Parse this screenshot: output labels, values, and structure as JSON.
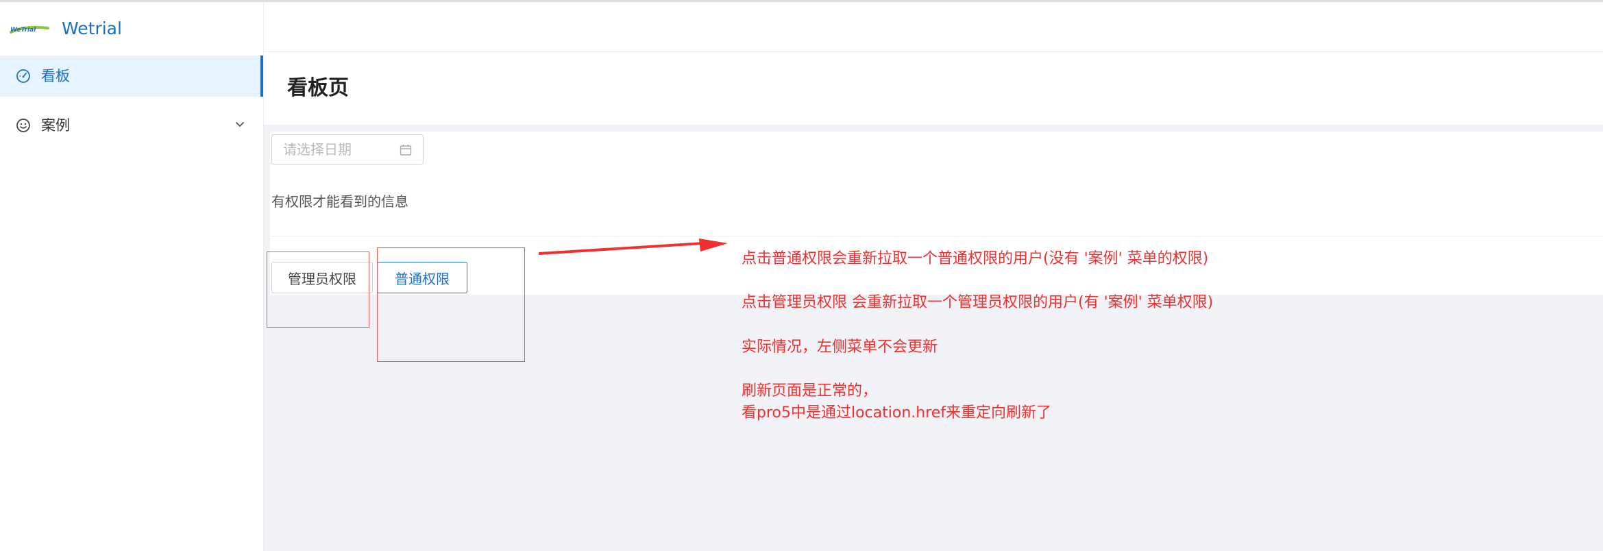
{
  "app": {
    "title": "Wetrial",
    "logo_text": "Wetrial"
  },
  "sidebar": {
    "items": [
      {
        "label": "看板",
        "icon": "dashboard-icon",
        "active": true
      },
      {
        "label": "案例",
        "icon": "smile-icon",
        "active": false,
        "has_submenu": true
      }
    ]
  },
  "page": {
    "title": "看板页"
  },
  "date_picker": {
    "placeholder": "请选择日期",
    "icon": "calendar-icon"
  },
  "content": {
    "info_text": "有权限才能看到的信息"
  },
  "buttons": {
    "admin_label": "管理员权限",
    "normal_label": "普通权限"
  },
  "annotations": {
    "line1": "点击普通权限会重新拉取一个普通权限的用户(没有 '案例' 菜单的权限)",
    "line2": "点击管理员权限 会重新拉取一个管理员权限的用户(有 '案例' 菜单权限)",
    "line3": "实际情况，左侧菜单不会更新",
    "line4": "刷新页面是正常的，",
    "line5": "看pro5中是通过location.href来重定向刷新了"
  },
  "colors": {
    "accent": "#1a6fc9",
    "annotation": "#f03030",
    "active_bg": "#e6f4ff",
    "content_bg": "#f0f2f5"
  }
}
